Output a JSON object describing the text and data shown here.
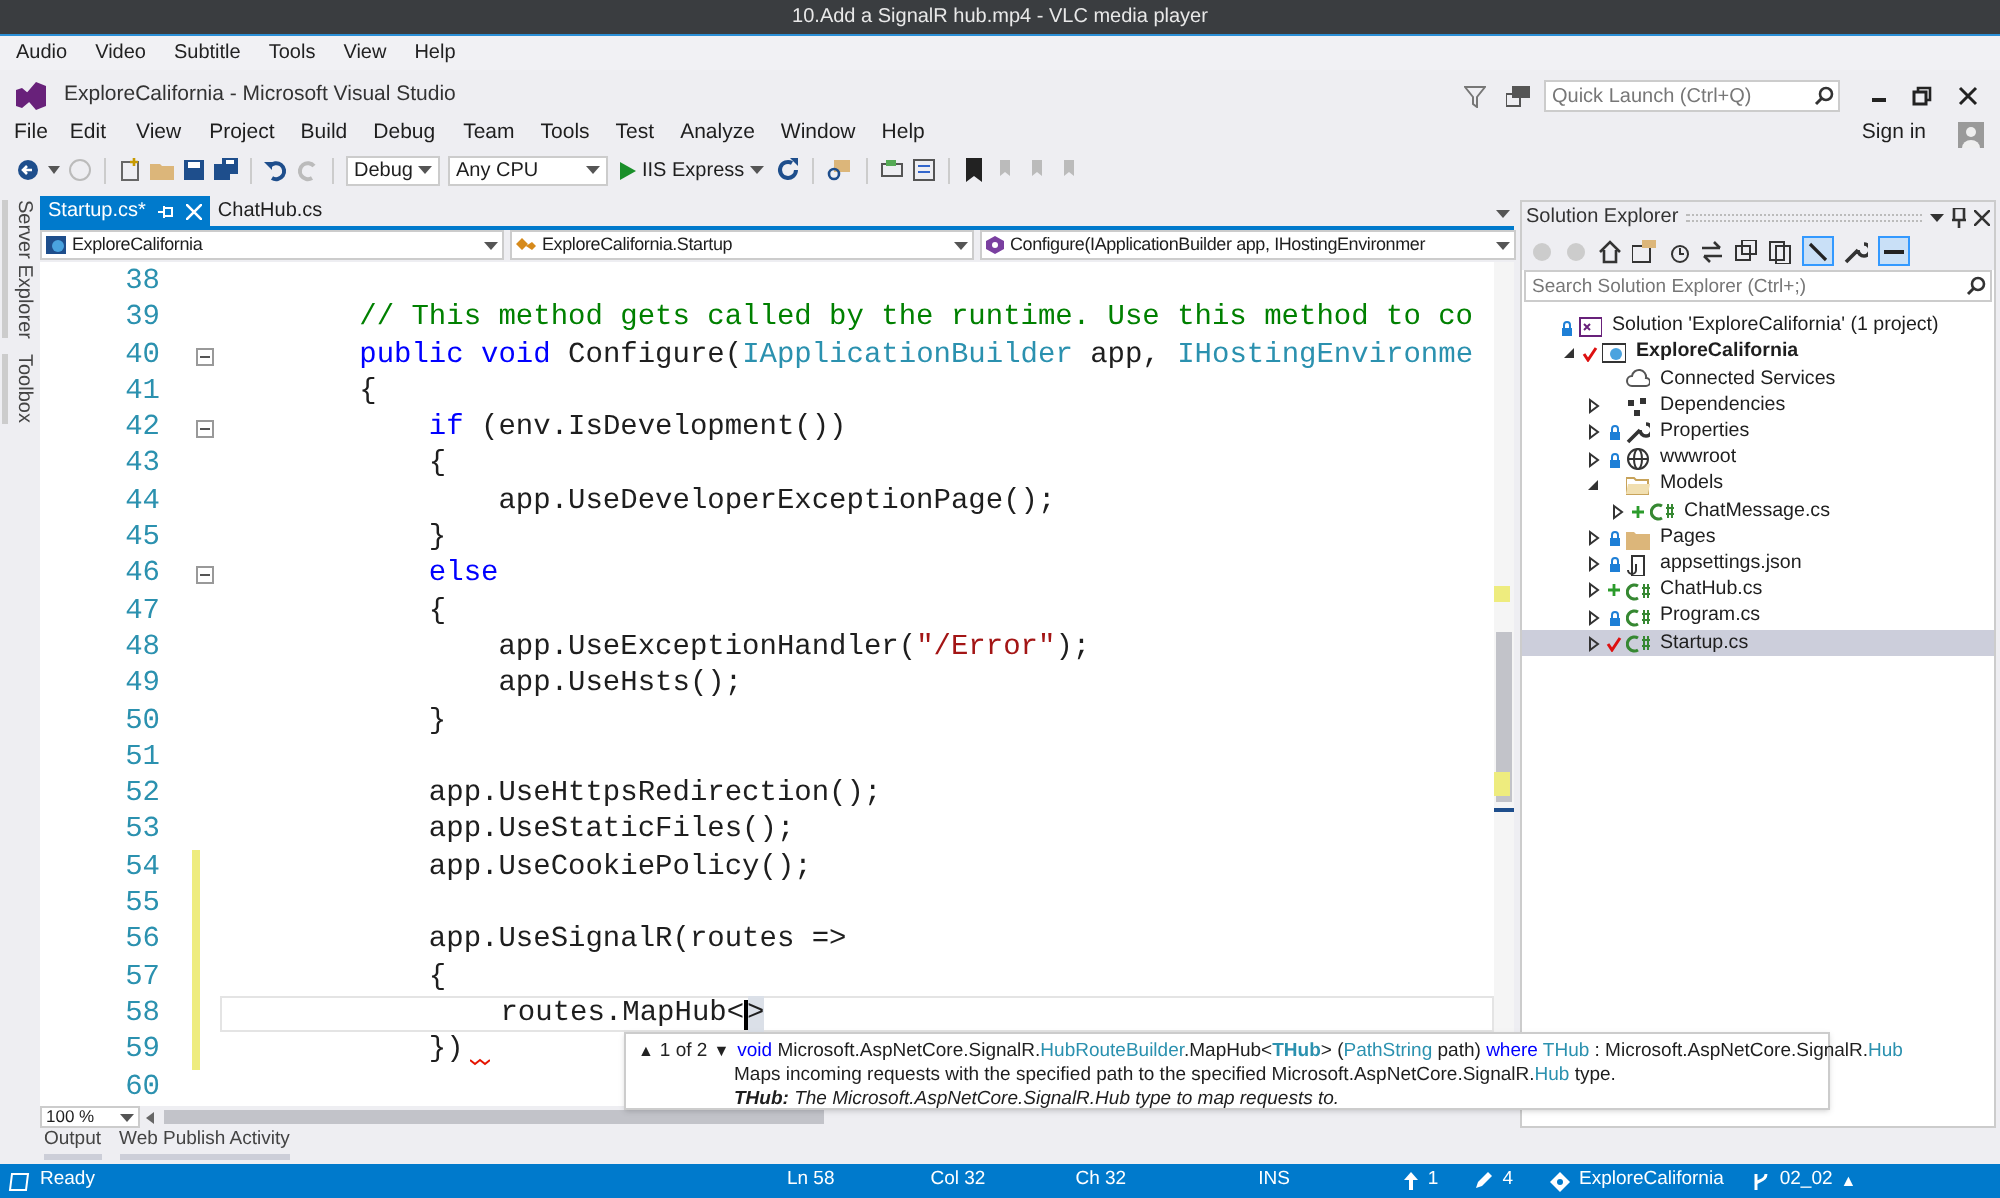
{
  "player_window": {
    "title": "10.Add a SignalR hub.mp4 - VLC media player"
  },
  "player_menu": [
    "Audio",
    "Video",
    "Subtitle",
    "Tools",
    "View",
    "Help"
  ],
  "window": {
    "title": "ExploreCalifornia - Microsoft Visual Studio",
    "quick_launch": {
      "placeholder": "Quick Launch (Ctrl+Q)"
    },
    "sign_in": "Sign in"
  },
  "menu": [
    "File",
    "Edit",
    "View",
    "Project",
    "Build",
    "Debug",
    "Team",
    "Tools",
    "Test",
    "Analyze",
    "Window",
    "Help"
  ],
  "toolbar": {
    "configuration": "Debug",
    "platform": "Any CPU",
    "run_target": "IIS Express"
  },
  "side_tabs": [
    "Server Explorer",
    "Toolbox"
  ],
  "editor_tabs": [
    {
      "label": "Startup.cs*",
      "selected": true
    },
    {
      "label": "ChatHub.cs",
      "selected": false
    }
  ],
  "navigation_bar": [
    "ExploreCalifornia",
    "ExploreCalifornia.Startup",
    "Configure(IApplicationBuilder app, IHostingEnvironmer"
  ],
  "code_lines": [
    {
      "number": "38"
    },
    {
      "number": "39",
      "tokens": [
        {
          "text": "        // This method gets called by the runtime. Use this method to co",
          "kind": "comment"
        }
      ]
    },
    {
      "number": "40",
      "fold": true,
      "tokens": [
        {
          "text": "        public ",
          "kind": "keyword"
        },
        {
          "text": "void",
          "kind": "keyword"
        },
        {
          "text": " Configure(",
          "kind": "plain"
        },
        {
          "text": "IApplicationBuilder",
          "kind": "type"
        },
        {
          "text": " app, ",
          "kind": "plain"
        },
        {
          "text": "IHostingEnvironme",
          "kind": "type"
        }
      ]
    },
    {
      "number": "41",
      "tokens": [
        {
          "text": "        {",
          "kind": "plain"
        }
      ]
    },
    {
      "number": "42",
      "fold": true,
      "tokens": [
        {
          "text": "            if",
          "kind": "keyword"
        },
        {
          "text": " (env.IsDevelopment())",
          "kind": "plain"
        }
      ]
    },
    {
      "number": "43",
      "tokens": [
        {
          "text": "            {",
          "kind": "plain"
        }
      ]
    },
    {
      "number": "44",
      "tokens": [
        {
          "text": "                app.UseDeveloperExceptionPage();",
          "kind": "plain"
        }
      ]
    },
    {
      "number": "45",
      "tokens": [
        {
          "text": "            }",
          "kind": "plain"
        }
      ]
    },
    {
      "number": "46",
      "fold": true,
      "tokens": [
        {
          "text": "            else",
          "kind": "keyword"
        }
      ]
    },
    {
      "number": "47",
      "tokens": [
        {
          "text": "            {",
          "kind": "plain"
        }
      ]
    },
    {
      "number": "48",
      "tokens": [
        {
          "text": "                app.UseExceptionHandler(",
          "kind": "plain"
        },
        {
          "text": "\"/Error\"",
          "kind": "string"
        },
        {
          "text": ");",
          "kind": "plain"
        }
      ]
    },
    {
      "number": "49",
      "tokens": [
        {
          "text": "                app.UseHsts();",
          "kind": "plain"
        }
      ]
    },
    {
      "number": "50",
      "tokens": [
        {
          "text": "            }",
          "kind": "plain"
        }
      ]
    },
    {
      "number": "51"
    },
    {
      "number": "52",
      "tokens": [
        {
          "text": "            app.UseHttpsRedirection();",
          "kind": "plain"
        }
      ]
    },
    {
      "number": "53",
      "tokens": [
        {
          "text": "            app.UseStaticFiles();",
          "kind": "plain"
        }
      ]
    },
    {
      "number": "54",
      "changed": true,
      "tokens": [
        {
          "text": "            app.UseCookiePolicy();",
          "kind": "plain"
        }
      ]
    },
    {
      "number": "55",
      "changed": true
    },
    {
      "number": "56",
      "changed": true,
      "tokens": [
        {
          "text": "            app.UseSignalR(routes =>",
          "kind": "plain"
        }
      ]
    },
    {
      "number": "57",
      "changed": true,
      "tokens": [
        {
          "text": "            {",
          "kind": "plain"
        }
      ]
    },
    {
      "number": "58",
      "changed": true,
      "current": true,
      "tokens": [
        {
          "text": "                routes.MapHub<",
          "kind": "plain"
        },
        {
          "text": ">",
          "kind": "brace_match"
        }
      ]
    },
    {
      "number": "59",
      "changed": true,
      "error": true,
      "tokens": [
        {
          "text": "            })",
          "kind": "plain"
        }
      ]
    },
    {
      "number": "60"
    }
  ],
  "zoom": "100 %",
  "signature_help": {
    "previous": "▲",
    "counter": "1 of 2",
    "next": "▼",
    "signature": [
      {
        "text": "void",
        "kind": "keyword"
      },
      {
        "text": " Microsoft.AspNetCore.SignalR.",
        "kind": "plain"
      },
      {
        "text": "HubRouteBuilder",
        "kind": "type"
      },
      {
        "text": ".MapHub<",
        "kind": "plain"
      },
      {
        "text": "THub",
        "kind": "param"
      },
      {
        "text": "> (",
        "kind": "plain"
      },
      {
        "text": "PathString",
        "kind": "type"
      },
      {
        "text": " path) ",
        "kind": "plain"
      },
      {
        "text": "where ",
        "kind": "keyword"
      },
      {
        "text": "THub",
        "kind": "type"
      },
      {
        "text": " : Microsoft.AspNetCore.SignalR.",
        "kind": "plain"
      },
      {
        "text": "Hub",
        "kind": "type"
      }
    ],
    "summary": [
      {
        "text": "Maps incoming requests with the specified path to the specified Microsoft.AspNetCore.SignalR.",
        "kind": "plain"
      },
      {
        "text": "Hub",
        "kind": "type"
      },
      {
        "text": " type.",
        "kind": "plain"
      }
    ],
    "parameter": "**THub:** The Microsoft.AspNetCore.SignalR.Hub type to map requests to."
  },
  "bottom_tabs": [
    "Output",
    "Web Publish Activity"
  ],
  "solution_explorer": {
    "title": "Solution Explorer",
    "search": {
      "placeholder": "Search Solution Explorer (Ctrl+;)"
    },
    "tree": [
      {
        "label": "Solution 'ExploreCalifornia' (1 project)",
        "kind": "solution",
        "locked": true,
        "selected": false,
        "children": [
          {
            "label": "ExploreCalifornia",
            "kind": "project",
            "checked_out": true,
            "expanded": true,
            "selected": false,
            "children": [
              {
                "label": "Connected Services",
                "kind": "cloud",
                "selected": false
              },
              {
                "label": "Dependencies",
                "kind": "dependencies",
                "expanded": false,
                "selected": false
              },
              {
                "label": "Properties",
                "kind": "wrench",
                "locked": true,
                "expanded": false,
                "selected": false
              },
              {
                "label": "wwwroot",
                "kind": "globe",
                "locked": true,
                "expanded": false,
                "selected": false
              },
              {
                "label": "Models",
                "kind": "folder",
                "expanded": true,
                "selected": false,
                "children": [
                  {
                    "label": "ChatMessage.cs",
                    "kind": "csharp",
                    "added": true,
                    "expanded": false,
                    "selected": false
                  }
                ]
              },
              {
                "label": "Pages",
                "kind": "folder",
                "locked": true,
                "expanded": false,
                "selected": false
              },
              {
                "label": "appsettings.json",
                "kind": "json",
                "locked": true,
                "expanded": false,
                "selected": false
              },
              {
                "label": "ChatHub.cs",
                "kind": "csharp",
                "added": true,
                "expanded": false,
                "selected": false
              },
              {
                "label": "Program.cs",
                "kind": "csharp",
                "locked": true,
                "expanded": false,
                "selected": false
              },
              {
                "label": "Startup.cs",
                "kind": "csharp",
                "checked_out": true,
                "expanded": false,
                "selected": true
              }
            ]
          }
        ]
      }
    ]
  },
  "status_bar": [
    {
      "text": "Ready",
      "kind": "ready"
    },
    {
      "text": "Ln 58",
      "kind": "position"
    },
    {
      "text": "Col 32",
      "kind": "position"
    },
    {
      "text": "Ch 32",
      "kind": "position"
    },
    {
      "text": "INS",
      "kind": "mode"
    },
    {
      "text": "1",
      "kind": "push"
    },
    {
      "text": "4",
      "kind": "edits"
    },
    {
      "text": "ExploreCalifornia",
      "kind": "repo"
    },
    {
      "text": "02_02",
      "kind": "branch"
    },
    {
      "text": "▲",
      "kind": "popup"
    }
  ]
}
